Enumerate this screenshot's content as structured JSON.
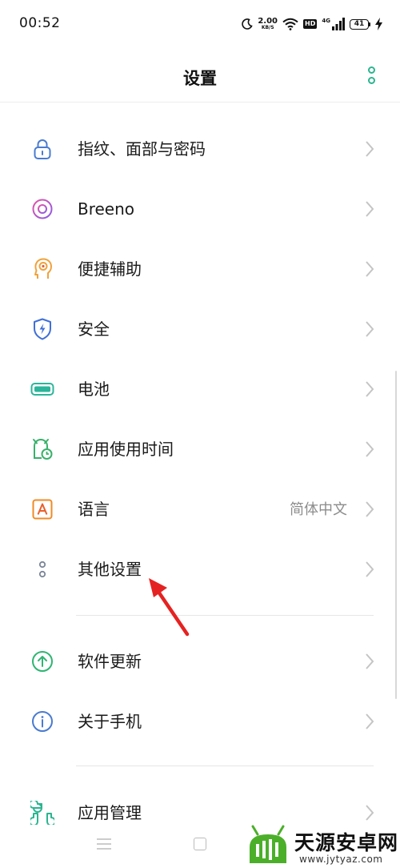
{
  "status_bar": {
    "time": "00:52",
    "net_speed_value": "2.00",
    "net_speed_unit": "KB/S",
    "hd_label": "HD",
    "network_type": "4G",
    "battery_level": "41",
    "icons": [
      "moon-icon",
      "wifi-icon",
      "signal-icon",
      "battery-icon",
      "charging-icon"
    ]
  },
  "header": {
    "title": "设置",
    "more_icon": "more-vertical-icon"
  },
  "settings": {
    "items": [
      {
        "label": "指纹、面部与密码",
        "icon": "lock-icon",
        "value": ""
      },
      {
        "label": "Breeno",
        "icon": "breeno-icon",
        "value": ""
      },
      {
        "label": "便捷辅助",
        "icon": "assist-icon",
        "value": ""
      },
      {
        "label": "安全",
        "icon": "shield-icon",
        "value": ""
      },
      {
        "label": "电池",
        "icon": "battery-icon",
        "value": ""
      },
      {
        "label": "应用使用时间",
        "icon": "app-timer-icon",
        "value": ""
      },
      {
        "label": "语言",
        "icon": "language-icon",
        "value": "简体中文"
      },
      {
        "label": "其他设置",
        "icon": "other-settings-icon",
        "value": ""
      },
      {
        "label": "软件更新",
        "icon": "update-icon",
        "value": ""
      },
      {
        "label": "关于手机",
        "icon": "info-icon",
        "value": ""
      },
      {
        "label": "应用管理",
        "icon": "app-management-icon",
        "value": ""
      }
    ]
  },
  "colors": {
    "accent": "#2bb58f",
    "lock": "#4a7bd0",
    "breeno": "#a85de0",
    "assist": "#f0a23b",
    "shield": "#3f6fd8",
    "battery": "#2bb59a",
    "timer": "#38b06a",
    "language": "#f08a24",
    "other": "#7a8599",
    "update": "#2fb573",
    "info": "#4a7bd0",
    "apps": "#2bb58f",
    "arrow": "#e52222"
  },
  "watermark": {
    "brand": "天源安卓网",
    "site": "www.jytyaz.com"
  }
}
